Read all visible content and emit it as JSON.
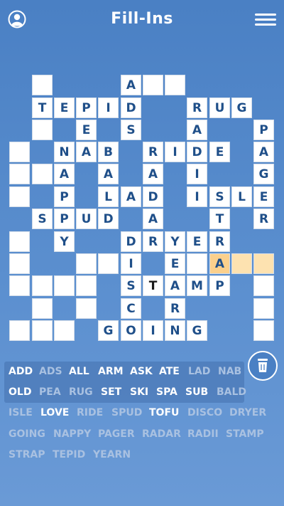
{
  "app": {
    "title": "Fill-Ins"
  },
  "colors": {
    "background": "#5b8fcf",
    "letter": "#1f4f89",
    "highlight": "#fde2b0",
    "cursor": "#fbd08c",
    "word_active": "#ffffff",
    "word_used": "#a9c1e1"
  },
  "icons": {
    "profile": "user-circle-icon",
    "menu": "hamburger-menu-icon",
    "clear": "trash-can-icon"
  },
  "grid": {
    "rows": [
      "....#..A##....",
      "...TEPID...RUG..",
      "...#E.S..A..#.P",
      "#NAB.RIDE.A..",
      "",
      "",
      "",
      "",
      "",
      "",
      "",
      "",
      ""
    ],
    "cells": [
      {
        "r": 0,
        "c": 1,
        "ch": ""
      },
      {
        "r": 0,
        "c": 5,
        "ch": "A"
      },
      {
        "r": 0,
        "c": 6,
        "ch": ""
      },
      {
        "r": 0,
        "c": 7,
        "ch": ""
      },
      {
        "r": 1,
        "c": 1,
        "ch": "T"
      },
      {
        "r": 1,
        "c": 2,
        "ch": "E"
      },
      {
        "r": 1,
        "c": 3,
        "ch": "P"
      },
      {
        "r": 1,
        "c": 4,
        "ch": "I"
      },
      {
        "r": 1,
        "c": 5,
        "ch": "D"
      },
      {
        "r": 1,
        "c": 8,
        "ch": "R"
      },
      {
        "r": 1,
        "c": 9,
        "ch": "U"
      },
      {
        "r": 1,
        "c": 10,
        "ch": "G"
      },
      {
        "r": 2,
        "c": 1,
        "ch": ""
      },
      {
        "r": 2,
        "c": 3,
        "ch": "E"
      },
      {
        "r": 2,
        "c": 5,
        "ch": "S"
      },
      {
        "r": 2,
        "c": 8,
        "ch": "A"
      },
      {
        "r": 2,
        "c": 11,
        "ch": "P"
      },
      {
        "r": 3,
        "c": 0,
        "ch": ""
      },
      {
        "r": 3,
        "c": 2,
        "ch": "N"
      },
      {
        "r": 3,
        "c": 3,
        "ch": "A"
      },
      {
        "r": 3,
        "c": 4,
        "ch": "B"
      },
      {
        "r": 3,
        "c": 6,
        "ch": "R"
      },
      {
        "r": 3,
        "c": 7,
        "ch": "I"
      },
      {
        "r": 3,
        "c": 8,
        "ch": "D"
      },
      {
        "r": 3,
        "c": 9,
        "ch": "E"
      },
      {
        "r": 3,
        "c": 11,
        "ch": "A"
      },
      {
        "r": 4,
        "c": 0,
        "ch": ""
      },
      {
        "r": 4,
        "c": 1,
        "ch": ""
      },
      {
        "r": 4,
        "c": 2,
        "ch": "A"
      },
      {
        "r": 4,
        "c": 4,
        "ch": "A"
      },
      {
        "r": 4,
        "c": 6,
        "ch": "A"
      },
      {
        "r": 4,
        "c": 8,
        "ch": "I"
      },
      {
        "r": 4,
        "c": 11,
        "ch": "G"
      },
      {
        "r": 5,
        "c": 0,
        "ch": ""
      },
      {
        "r": 5,
        "c": 2,
        "ch": "P"
      },
      {
        "r": 5,
        "c": 4,
        "ch": "L"
      },
      {
        "r": 5,
        "c": 5,
        "ch": "A"
      },
      {
        "r": 5,
        "c": 6,
        "ch": "D"
      },
      {
        "r": 5,
        "c": 8,
        "ch": "I"
      },
      {
        "r": 5,
        "c": 9,
        "ch": "S"
      },
      {
        "r": 5,
        "c": 10,
        "ch": "L"
      },
      {
        "r": 5,
        "c": 11,
        "ch": "E"
      },
      {
        "r": 6,
        "c": 1,
        "ch": "S"
      },
      {
        "r": 6,
        "c": 2,
        "ch": "P"
      },
      {
        "r": 6,
        "c": 3,
        "ch": "U"
      },
      {
        "r": 6,
        "c": 4,
        "ch": "D"
      },
      {
        "r": 6,
        "c": 6,
        "ch": "A"
      },
      {
        "r": 6,
        "c": 9,
        "ch": "T"
      },
      {
        "r": 6,
        "c": 11,
        "ch": "R"
      },
      {
        "r": 7,
        "c": 0,
        "ch": ""
      },
      {
        "r": 7,
        "c": 2,
        "ch": "Y"
      },
      {
        "r": 7,
        "c": 5,
        "ch": "D"
      },
      {
        "r": 7,
        "c": 6,
        "ch": "R"
      },
      {
        "r": 7,
        "c": 7,
        "ch": "Y"
      },
      {
        "r": 7,
        "c": 8,
        "ch": "E"
      },
      {
        "r": 7,
        "c": 9,
        "ch": "R"
      },
      {
        "r": 8,
        "c": 0,
        "ch": ""
      },
      {
        "r": 8,
        "c": 3,
        "ch": ""
      },
      {
        "r": 8,
        "c": 4,
        "ch": ""
      },
      {
        "r": 8,
        "c": 5,
        "ch": "I"
      },
      {
        "r": 8,
        "c": 7,
        "ch": "E"
      },
      {
        "r": 8,
        "c": 8,
        "ch": ""
      },
      {
        "r": 8,
        "c": 9,
        "ch": "A",
        "st": "cur"
      },
      {
        "r": 8,
        "c": 10,
        "ch": "",
        "st": "hl"
      },
      {
        "r": 8,
        "c": 11,
        "ch": "",
        "st": "hl"
      },
      {
        "r": 9,
        "c": 0,
        "ch": ""
      },
      {
        "r": 9,
        "c": 1,
        "ch": ""
      },
      {
        "r": 9,
        "c": 2,
        "ch": ""
      },
      {
        "r": 9,
        "c": 3,
        "ch": ""
      },
      {
        "r": 9,
        "c": 5,
        "ch": "S"
      },
      {
        "r": 9,
        "c": 6,
        "ch": "T",
        "st": "typed"
      },
      {
        "r": 9,
        "c": 7,
        "ch": "A"
      },
      {
        "r": 9,
        "c": 8,
        "ch": "M"
      },
      {
        "r": 9,
        "c": 9,
        "ch": "P"
      },
      {
        "r": 9,
        "c": 11,
        "ch": ""
      },
      {
        "r": 10,
        "c": 1,
        "ch": ""
      },
      {
        "r": 10,
        "c": 3,
        "ch": ""
      },
      {
        "r": 10,
        "c": 5,
        "ch": "C"
      },
      {
        "r": 10,
        "c": 7,
        "ch": "R"
      },
      {
        "r": 10,
        "c": 11,
        "ch": ""
      },
      {
        "r": 11,
        "c": 0,
        "ch": ""
      },
      {
        "r": 11,
        "c": 1,
        "ch": ""
      },
      {
        "r": 11,
        "c": 2,
        "ch": ""
      },
      {
        "r": 11,
        "c": 4,
        "ch": "G"
      },
      {
        "r": 11,
        "c": 5,
        "ch": "O"
      },
      {
        "r": 11,
        "c": 6,
        "ch": "I"
      },
      {
        "r": 11,
        "c": 7,
        "ch": "N"
      },
      {
        "r": 11,
        "c": 8,
        "ch": "G"
      },
      {
        "r": 11,
        "c": 11,
        "ch": ""
      }
    ]
  },
  "word_rows": [
    [
      {
        "w": "ADD",
        "s": "active"
      },
      {
        "w": "ADS",
        "s": "used"
      },
      {
        "w": "ALL",
        "s": "active"
      },
      {
        "w": "ARM",
        "s": "active"
      },
      {
        "w": "ASK",
        "s": "active"
      },
      {
        "w": "ATE",
        "s": "active"
      },
      {
        "w": "LAD",
        "s": "used"
      },
      {
        "w": "NAB",
        "s": "used"
      }
    ],
    [
      {
        "w": "OLD",
        "s": "active"
      },
      {
        "w": "PEA",
        "s": "used"
      },
      {
        "w": "RUG",
        "s": "used"
      },
      {
        "w": "SET",
        "s": "active"
      },
      {
        "w": "SKI",
        "s": "active"
      },
      {
        "w": "SPA",
        "s": "active"
      },
      {
        "w": "SUB",
        "s": "active"
      },
      {
        "w": "BALD",
        "s": "used"
      }
    ],
    [
      {
        "w": "ISLE",
        "s": "used"
      },
      {
        "w": "LOVE",
        "s": "active"
      },
      {
        "w": "RIDE",
        "s": "used"
      },
      {
        "w": "SPUD",
        "s": "used"
      },
      {
        "w": "TOFU",
        "s": "active"
      },
      {
        "w": "DISCO",
        "s": "used"
      },
      {
        "w": "DRYER",
        "s": "used"
      }
    ],
    [
      {
        "w": "GOING",
        "s": "used"
      },
      {
        "w": "NAPPY",
        "s": "used"
      },
      {
        "w": "PAGER",
        "s": "used"
      },
      {
        "w": "RADAR",
        "s": "used"
      },
      {
        "w": "RADII",
        "s": "used"
      },
      {
        "w": "STAMP",
        "s": "used"
      }
    ],
    [
      {
        "w": "STRAP",
        "s": "used"
      },
      {
        "w": "TEPID",
        "s": "used"
      },
      {
        "w": "YEARN",
        "s": "used"
      }
    ]
  ]
}
